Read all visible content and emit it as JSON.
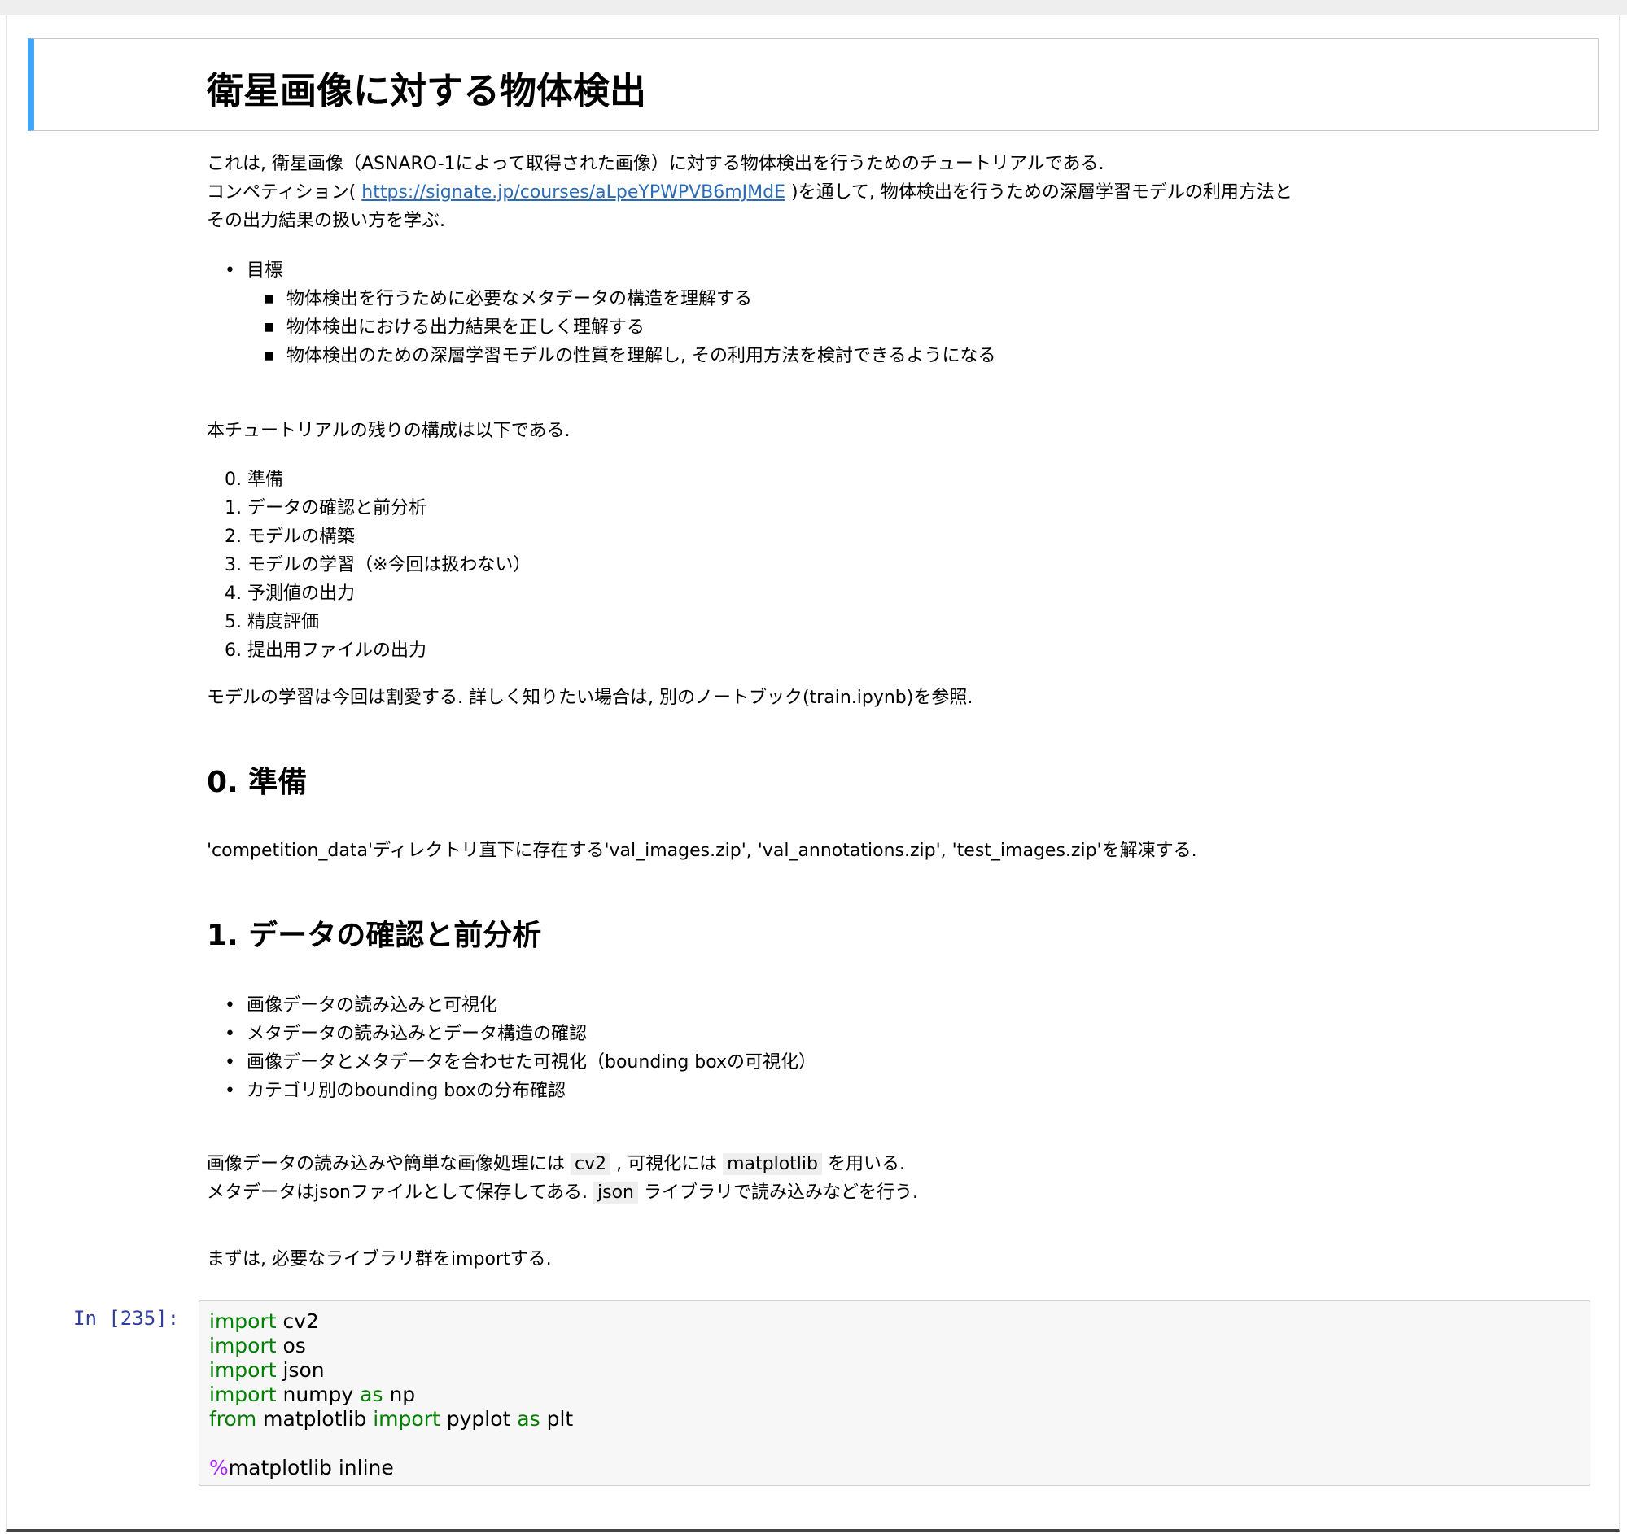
{
  "header": {
    "title": "衛星画像に対する物体検出"
  },
  "intro": {
    "line1": "これは, 衛星画像（ASNARO-1によって取得された画像）に対する物体検出を行うためのチュートリアルである.",
    "line2_pre": "コンペティション( ",
    "line2_link": "https://signate.jp/courses/aLpeYPWPVB6mJMdE",
    "line2_post": " )を通して, 物体検出を行うための深層学習モデルの利用方法と",
    "line3": "その出力結果の扱い方を学ぶ."
  },
  "goals": {
    "label": "目標",
    "items": [
      "物体検出を行うために必要なメタデータの構造を理解する",
      "物体検出における出力結果を正しく理解する",
      "物体検出のための深層学習モデルの性質を理解し, その利用方法を検討できるようになる"
    ]
  },
  "structure": {
    "intro": "本チュートリアルの残りの構成は以下である.",
    "items": [
      "0. 準備",
      "1. データの確認と前分析",
      "2. モデルの構築",
      "3. モデルの学習（※今回は扱わない）",
      "4. 予測値の出力",
      "5. 精度評価",
      "6. 提出用ファイルの出力"
    ],
    "note": "モデルの学習は今回は割愛する. 詳しく知りたい場合は, 別のノートブック(train.ipynb)を参照."
  },
  "section0": {
    "heading": "0. 準備",
    "text": "'competition_data'ディレクトリ直下に存在する'val_images.zip', 'val_annotations.zip', 'test_images.zip'を解凍する."
  },
  "section1": {
    "heading": "1. データの確認と前分析",
    "bullets": [
      "画像データの読み込みと可視化",
      "メタデータの読み込みとデータ構造の確認",
      "画像データとメタデータを合わせた可視化（bounding boxの可視化）",
      "カテゴリ別のbounding boxの分布確認"
    ],
    "p1_pre": "画像データの読み込みや簡単な画像処理には ",
    "p1_code1": "cv2",
    "p1_mid": " , 可視化には ",
    "p1_code2": "matplotlib",
    "p1_post": " を用いる.",
    "p2_pre": "メタデータはjsonファイルとして保存してある. ",
    "p2_code": "json",
    "p2_post": " ライブラリで読み込みなどを行う.",
    "p3": "まずは, 必要なライブラリ群をimportする."
  },
  "code_cell": {
    "prompt": "In [235]:",
    "kw_import": "import",
    "kw_from": "from",
    "kw_as": "as",
    "magic": "%",
    "l1_rest": " cv2",
    "l2_rest": " os",
    "l3_rest": " json",
    "l4_mid": " numpy ",
    "l4_end": " np",
    "l5_mid": " matplotlib ",
    "l5_mid2": " pyplot ",
    "l5_end": " plt",
    "l7_rest": "matplotlib inline"
  }
}
